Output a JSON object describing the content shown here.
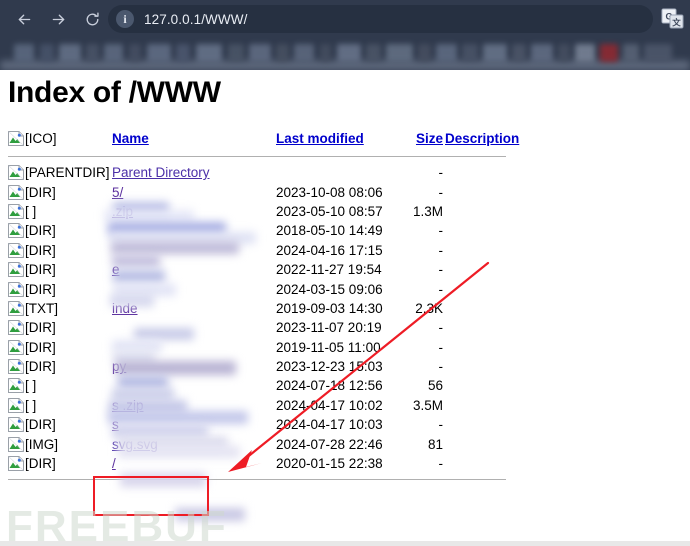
{
  "browser": {
    "back_label": "Back",
    "forward_label": "Forward",
    "reload_label": "Reload",
    "site_info_label": "i",
    "url": "127.0.0.1/WWW/",
    "translate_label": "Translate this page"
  },
  "page": {
    "title": "Index of /WWW",
    "watermark": "FREEBUF"
  },
  "table": {
    "headers": {
      "icon": "[ICO]",
      "name": "Name",
      "last_modified": "Last modified",
      "size": "Size",
      "description": "Description"
    },
    "rows": [
      {
        "icon": "[PARENTDIR]",
        "name": "Parent Directory",
        "redacted": false,
        "date": "",
        "size": "-",
        "desc": ""
      },
      {
        "icon": "[DIR]",
        "name": "5/",
        "redacted": true,
        "date": "2023-10-08 08:06",
        "size": "-",
        "desc": ""
      },
      {
        "icon": "[ ]",
        "name": ".zip",
        "redacted": true,
        "date": "2023-05-10 08:57",
        "size": "1.3M",
        "desc": ""
      },
      {
        "icon": "[DIR]",
        "name": "",
        "redacted": true,
        "date": "2018-05-10 14:49",
        "size": "-",
        "desc": ""
      },
      {
        "icon": "[DIR]",
        "name": "",
        "redacted": true,
        "date": "2024-04-16 17:15",
        "size": "-",
        "desc": ""
      },
      {
        "icon": "[DIR]",
        "name": "e",
        "redacted": true,
        "date": "2022-11-27 19:54",
        "size": "-",
        "desc": ""
      },
      {
        "icon": "[DIR]",
        "name": "",
        "redacted": true,
        "date": "2024-03-15 09:06",
        "size": "-",
        "desc": ""
      },
      {
        "icon": "[TXT]",
        "name": "inde",
        "redacted": true,
        "date": "2019-09-03 14:30",
        "size": "2.3K",
        "desc": ""
      },
      {
        "icon": "[DIR]",
        "name": "",
        "redacted": true,
        "date": "2023-11-07 20:19",
        "size": "-",
        "desc": ""
      },
      {
        "icon": "[DIR]",
        "name": "",
        "redacted": true,
        "date": "2019-11-05 11:00",
        "size": "-",
        "desc": ""
      },
      {
        "icon": "[DIR]",
        "name": "py",
        "redacted": true,
        "date": "2023-12-23 15:03",
        "size": "-",
        "desc": ""
      },
      {
        "icon": "[ ]",
        "name": "",
        "redacted": true,
        "date": "2024-07-18 12:56",
        "size": "56",
        "desc": ""
      },
      {
        "icon": "[ ]",
        "name": "s .zip",
        "redacted": true,
        "date": "2024-04-17 10:02",
        "size": "3.5M",
        "desc": ""
      },
      {
        "icon": "[DIR]",
        "name": "s",
        "redacted": true,
        "date": "2024-04-17 10:03",
        "size": "-",
        "desc": ""
      },
      {
        "icon": "[IMG]",
        "name": "svg.svg",
        "redacted": false,
        "date": "2024-07-28 22:46",
        "size": "81",
        "desc": ""
      },
      {
        "icon": "[DIR]",
        "name": "/",
        "redacted": true,
        "date": "2020-01-15 22:38",
        "size": "-",
        "desc": ""
      }
    ]
  },
  "annotations": {
    "arrow_color": "#ee1c25",
    "highlight_color": "#ee1c25",
    "highlight_target": "svg.svg"
  },
  "colors": {
    "chrome_bg": "#303a4d",
    "omnibox_bg": "#263041",
    "link": "#0000cc",
    "visited_link": "#4b2fa8",
    "accent_red": "#ee1c25"
  }
}
